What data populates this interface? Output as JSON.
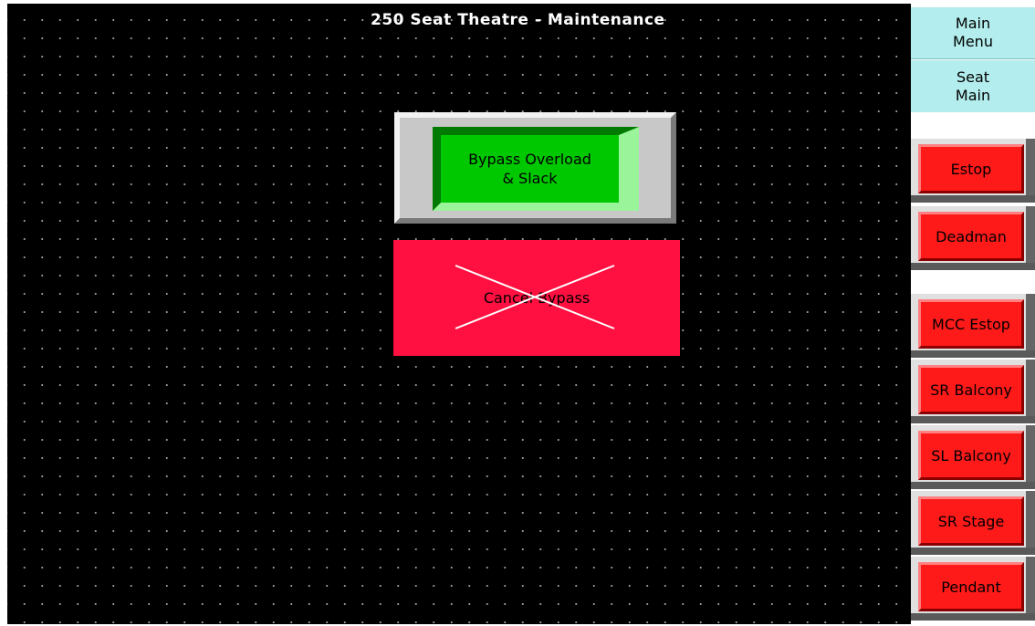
{
  "header": {
    "title": "250 Seat Theatre - Maintenance"
  },
  "main": {
    "bypass_button": {
      "label": "Bypass Overload\n& Slack",
      "color": "#00c800"
    },
    "cancel_bypass_button": {
      "label": "Cancel Bypass",
      "color": "#ff1040",
      "crossed_out": true
    }
  },
  "sidebar": {
    "nav": [
      {
        "label": "Main\nMenu"
      },
      {
        "label": "Seat\nMain"
      }
    ],
    "status_buttons": [
      {
        "label": "Estop"
      },
      {
        "label": "Deadman"
      },
      {
        "label": "MCC Estop"
      },
      {
        "label": "SR Balcony"
      },
      {
        "label": "SL Balcony"
      },
      {
        "label": "SR Stage"
      },
      {
        "label": "Pendant"
      }
    ],
    "status_color": "#ff1a1a",
    "nav_color": "#b3eded"
  }
}
